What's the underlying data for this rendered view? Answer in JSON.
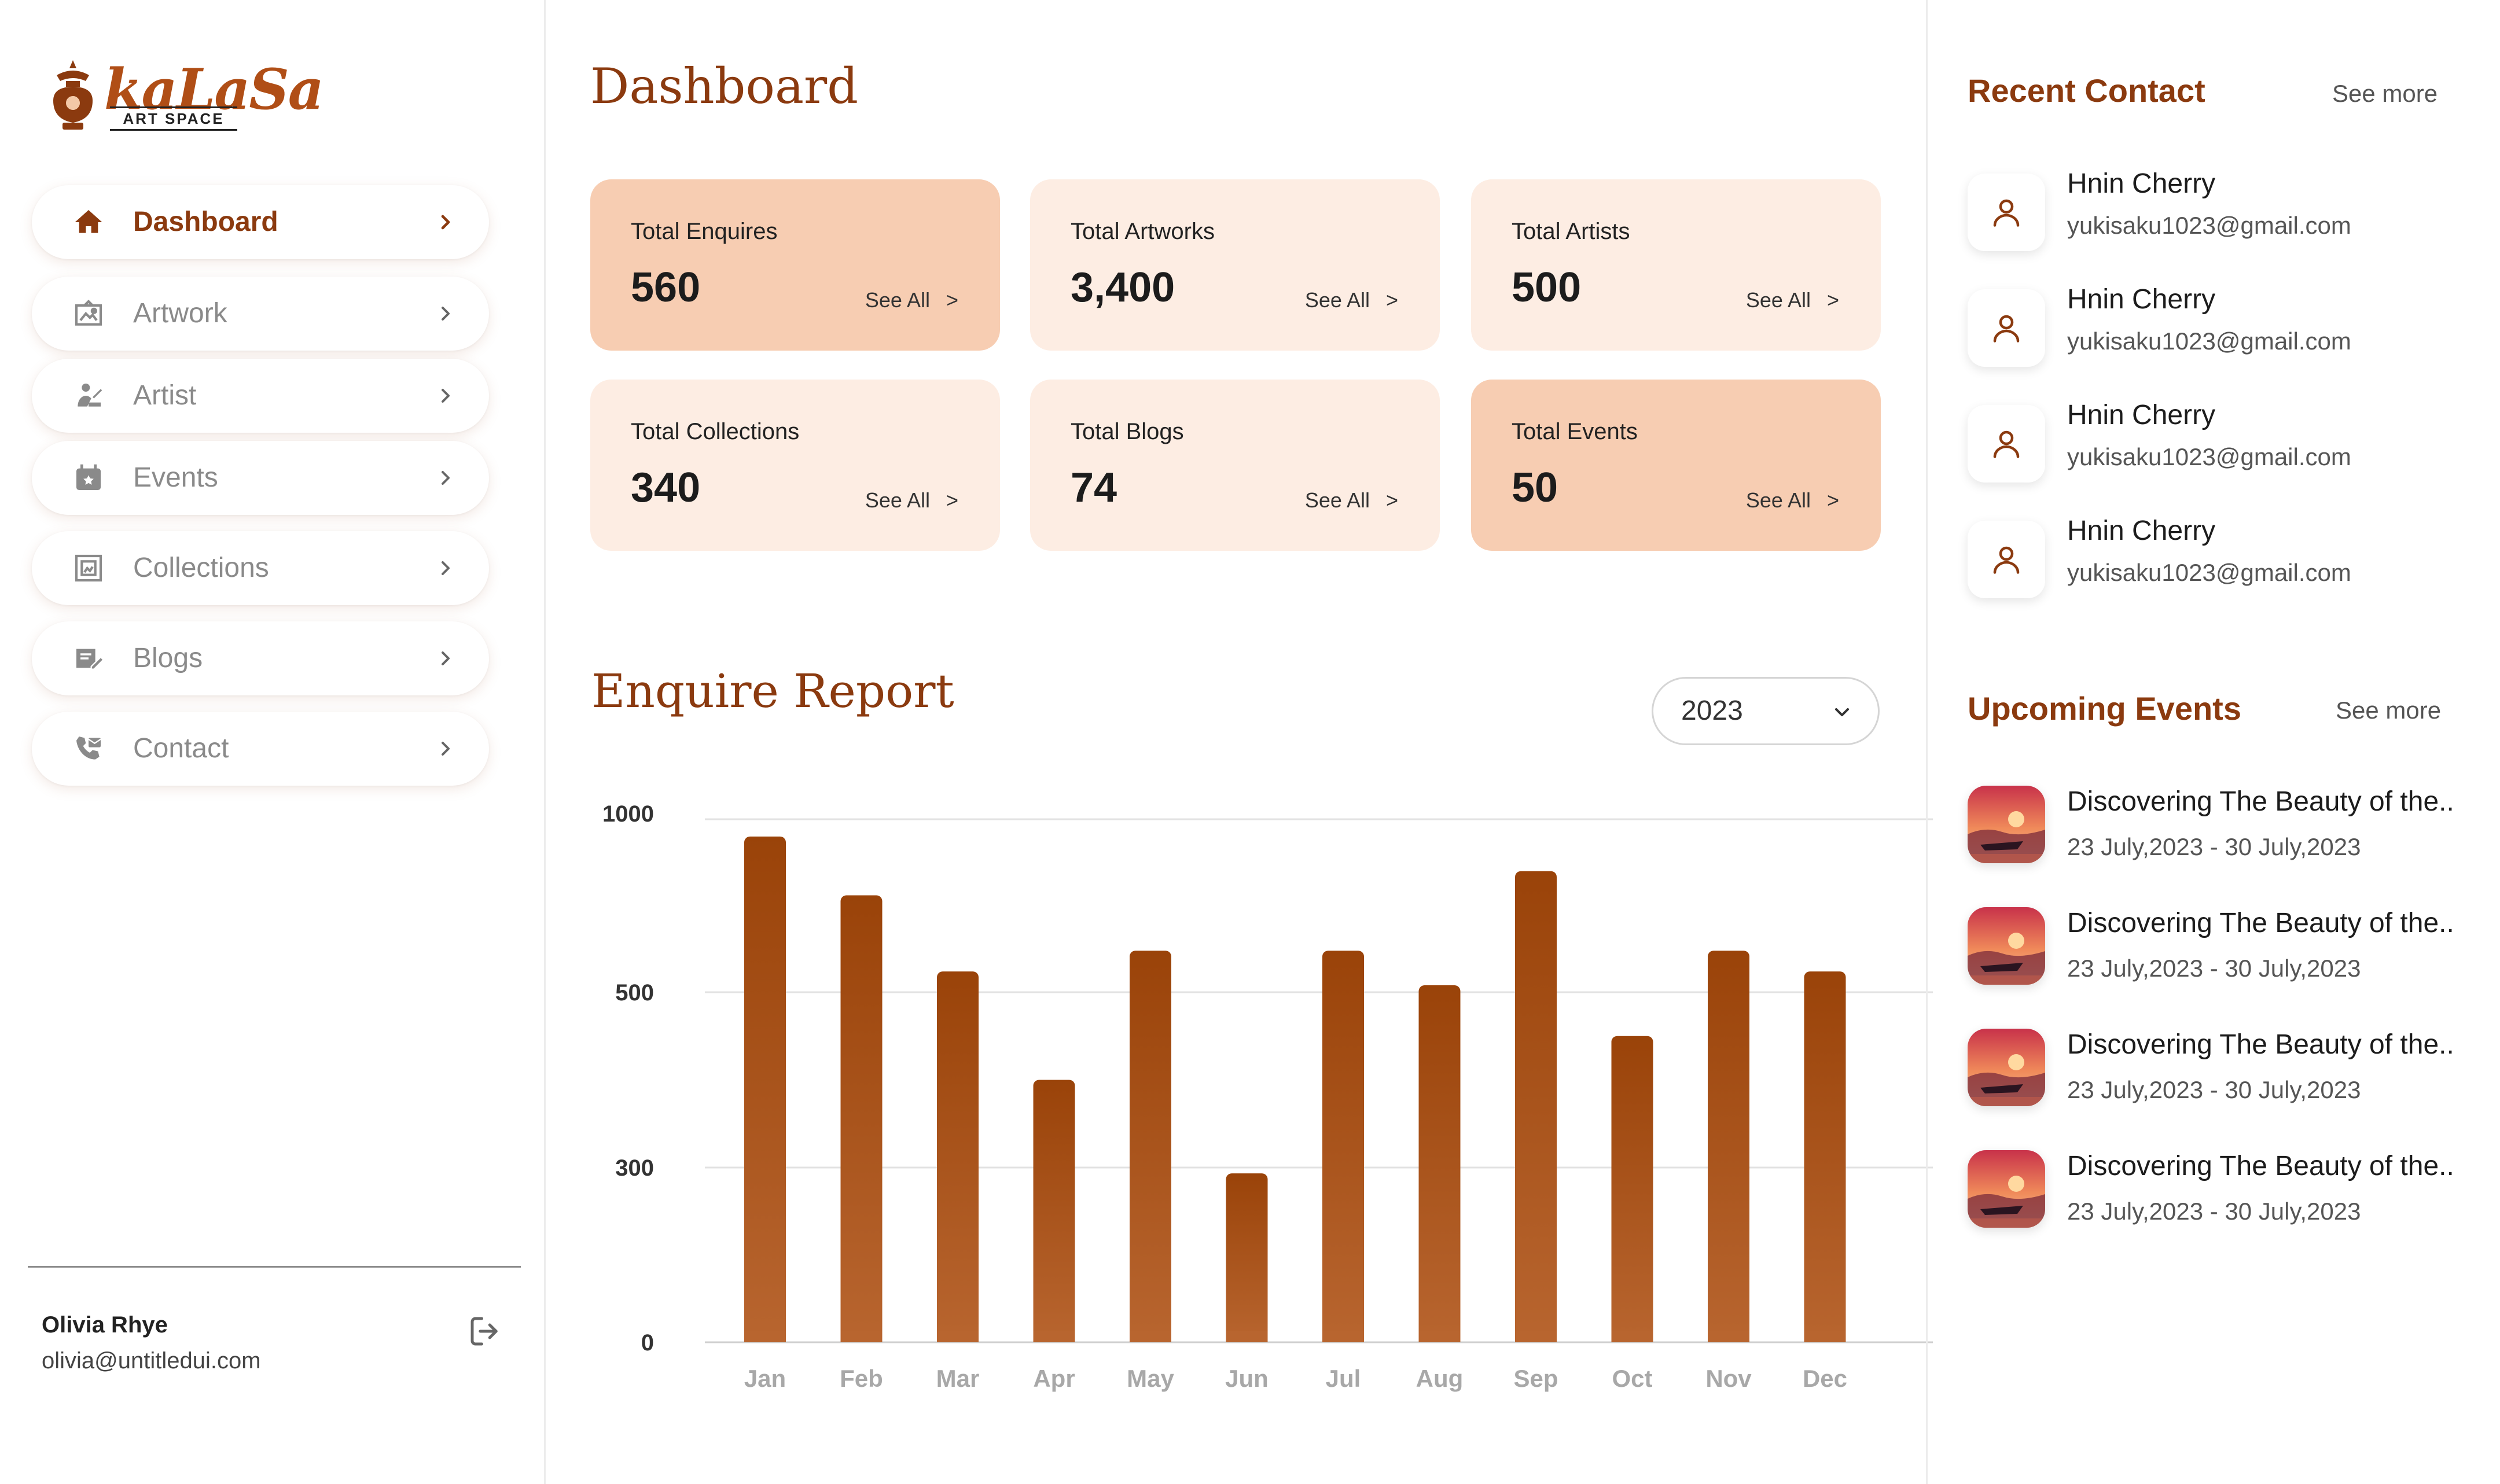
{
  "brand": {
    "name": "kaLaSa",
    "tagline": "ART SPACE",
    "accent": "#8b3a0f",
    "card_dark": "#f7cdb2",
    "card_light": "#fdede3"
  },
  "sidebar": {
    "items": [
      {
        "label": "Dashboard",
        "icon": "home-icon",
        "active": true
      },
      {
        "label": "Artwork",
        "icon": "artwork-icon",
        "active": false
      },
      {
        "label": "Artist",
        "icon": "artist-icon",
        "active": false
      },
      {
        "label": "Events",
        "icon": "calendar-icon",
        "active": false
      },
      {
        "label": "Collections",
        "icon": "collections-icon",
        "active": false
      },
      {
        "label": "Blogs",
        "icon": "blog-icon",
        "active": false
      },
      {
        "label": "Contact",
        "icon": "phone-icon",
        "active": false
      }
    ],
    "user": {
      "name": "Olivia Rhye",
      "email": "olivia@untitledui.com"
    }
  },
  "main": {
    "title": "Dashboard",
    "cards": [
      {
        "label": "Total Enquires",
        "value": "560",
        "link": "See All",
        "arrow": ">"
      },
      {
        "label": "Total Artworks",
        "value": "3,400",
        "link": "See All",
        "arrow": ">"
      },
      {
        "label": "Total Artists",
        "value": "500",
        "link": "See All",
        "arrow": ">"
      },
      {
        "label": "Total Collections",
        "value": "340",
        "link": "See All",
        "arrow": ">"
      },
      {
        "label": "Total Blogs",
        "value": "74",
        "link": "See All",
        "arrow": ">"
      },
      {
        "label": "Total Events",
        "value": "50",
        "link": "See All",
        "arrow": ">"
      }
    ],
    "report_title": "Enquire Report",
    "year_select": {
      "value": "2023"
    }
  },
  "chart_data": {
    "type": "bar",
    "title": "Enquire Report",
    "categories": [
      "Jan",
      "Feb",
      "Mar",
      "Apr",
      "May",
      "Jun",
      "Jul",
      "Aug",
      "Sep",
      "Oct",
      "Nov",
      "Dec"
    ],
    "values": [
      950,
      780,
      560,
      400,
      620,
      290,
      620,
      520,
      850,
      450,
      620,
      560
    ],
    "ytick_labels": [
      "1000",
      "500",
      "300",
      "0"
    ],
    "grid": true,
    "bar_color_top": "#9a4309",
    "bar_color_bottom": "#b8652f"
  },
  "right": {
    "contacts_title": "Recent Contact",
    "contacts_more": "See more",
    "contacts": [
      {
        "name": "Hnin Cherry",
        "email": "yukisaku1023@gmail.com"
      },
      {
        "name": "Hnin Cherry",
        "email": "yukisaku1023@gmail.com"
      },
      {
        "name": "Hnin Cherry",
        "email": "yukisaku1023@gmail.com"
      },
      {
        "name": "Hnin Cherry",
        "email": "yukisaku1023@gmail.com"
      }
    ],
    "events_title": "Upcoming Events",
    "events_more": "See more",
    "events": [
      {
        "title": "Discovering The Beauty of the..",
        "date": "23 July,2023 - 30 July,2023"
      },
      {
        "title": "Discovering The Beauty of the..",
        "date": "23 July,2023 - 30 July,2023"
      },
      {
        "title": "Discovering The Beauty of the..",
        "date": "23 July,2023 - 30 July,2023"
      },
      {
        "title": "Discovering The Beauty of the..",
        "date": "23 July,2023 - 30 July,2023"
      }
    ]
  }
}
